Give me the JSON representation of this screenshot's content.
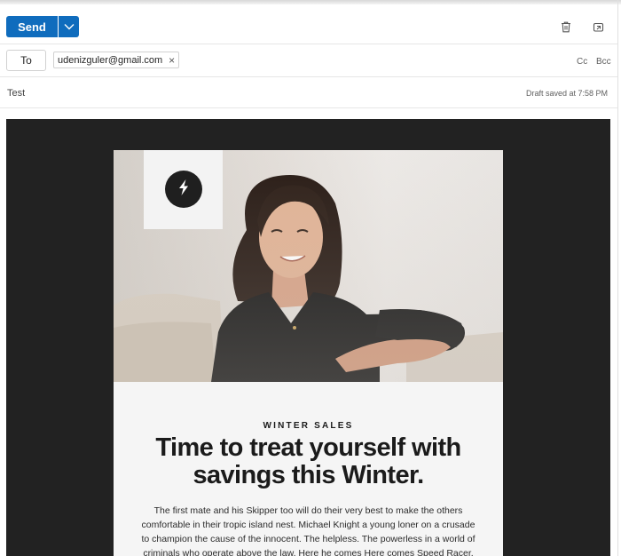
{
  "toolbar": {
    "send_label": "Send",
    "icons": [
      "send-options-chevron-icon",
      "trash-icon",
      "popout-icon"
    ]
  },
  "recipients": {
    "to_label": "To",
    "to_chip": "udenizguler@gmail.com",
    "cc_label": "Cc",
    "bcc_label": "Bcc"
  },
  "subject": {
    "value": "Test",
    "draft_status": "Draft saved at 7:58 PM"
  },
  "email": {
    "logo_icon": "lightning-bolt-icon",
    "hero_alt": "smiling woman in black sweater",
    "eyebrow": "WINTER SALES",
    "headline": "Time to treat yourself with savings this Winter.",
    "paragraph": "The first mate and his Skipper too will do their very best to make the others comfortable in their tropic island nest. Michael Knight a young loner on a crusade to champion the cause of the innocent. The helpless. The powerless in a world of criminals who operate above the law. Here he comes Here comes Speed Racer. He's a"
  },
  "colors": {
    "accent": "#0f6cbd",
    "canvas": "#222222",
    "email_bg": "#f5f5f5"
  }
}
